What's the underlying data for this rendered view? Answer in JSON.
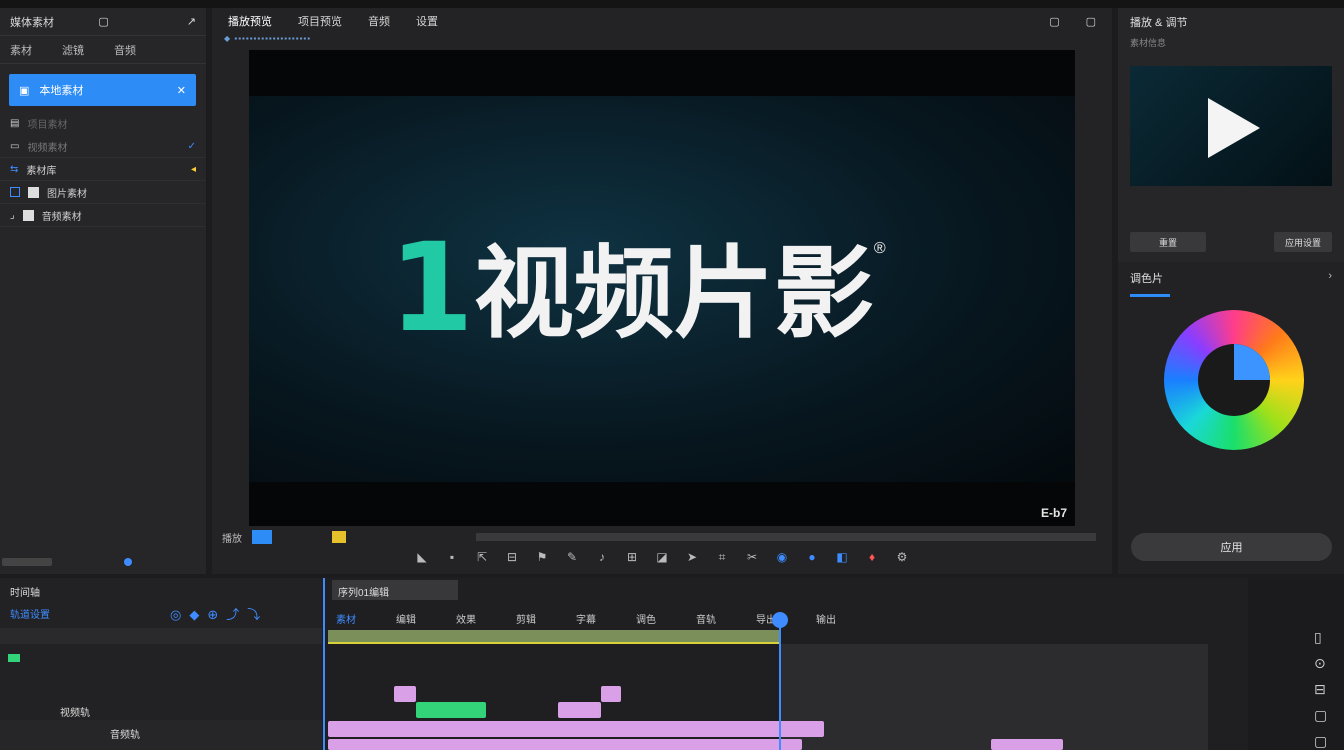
{
  "app": {
    "title": "1视频片影"
  },
  "left_panel": {
    "header_label": "媒体素材",
    "tabs": [
      "素材",
      "滤镜",
      "音频"
    ],
    "active_item": "本地素材",
    "rows": [
      {
        "label": "项目素材",
        "value": ""
      },
      {
        "label": "视频素材",
        "value": ""
      },
      {
        "label": "素材库",
        "value": ""
      },
      {
        "label": "图片素材",
        "value": ""
      },
      {
        "label": "音频素材",
        "value": ""
      }
    ]
  },
  "preview": {
    "tabs": [
      "播放预览",
      "项目预览",
      "音频",
      "设置"
    ],
    "brand_number": "1",
    "brand_text": "视频片影",
    "brand_reg": "®",
    "watermark": "E-b7",
    "bottom_label": "播放"
  },
  "right_panel": {
    "title": "播放 & 调节",
    "subtitle": "素材信息",
    "reset_button": "重置",
    "save_button": "应用设置",
    "color_section_title": "调色片",
    "apply_button": "应用"
  },
  "timeline": {
    "header_label": "时间轴",
    "track_group_label": "轨道设置",
    "sequence_tab": "序列01编辑",
    "marker_labels": [
      "素材",
      "编辑",
      "效果",
      "剪辑",
      "字幕",
      "调色",
      "音轨",
      "导出",
      "输出"
    ],
    "track_labels": [
      "视频轨",
      "音频轨"
    ]
  },
  "colors": {
    "accent": "#2e8cf6",
    "brand_green": "#21c9a4",
    "clip_pink": "#d9a0e8",
    "clip_green": "#33d37a"
  }
}
